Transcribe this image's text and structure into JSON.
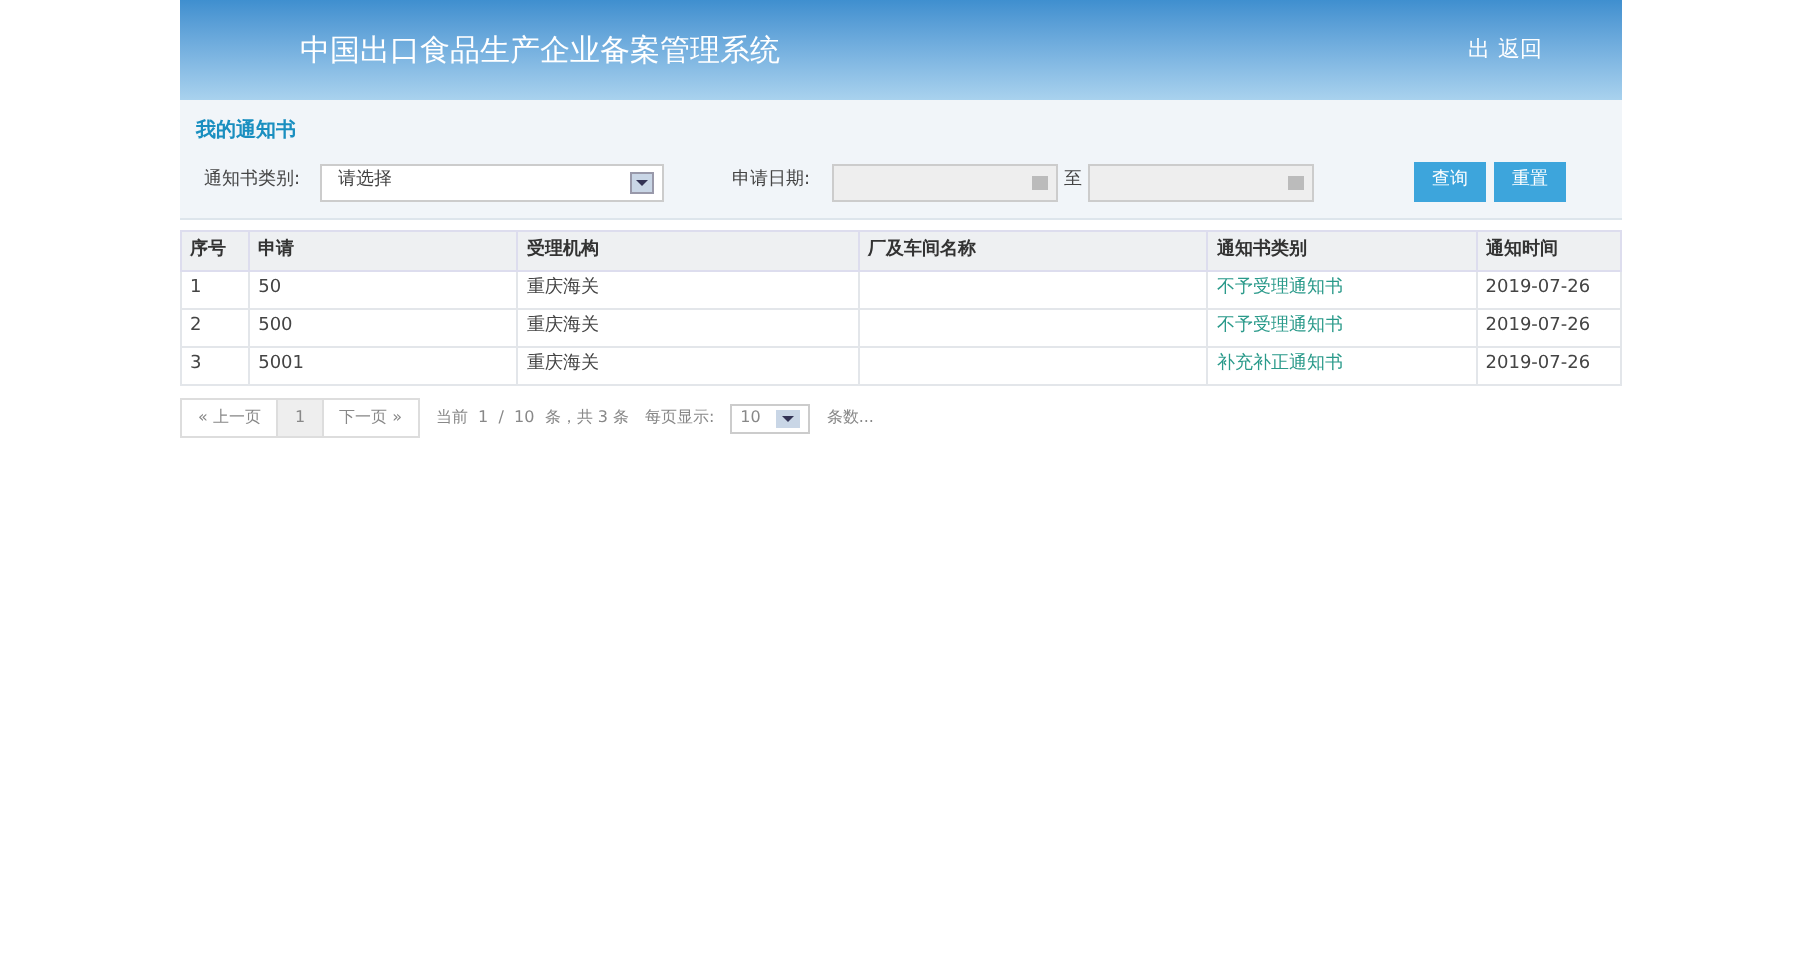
{
  "header": {
    "title": "中国出口食品生产企业备案管理系统",
    "links": [
      "出",
      "返回"
    ]
  },
  "panel": {
    "title": "我的通知书",
    "filters": {
      "type_label": "通知书类别:",
      "type_value": "请选择",
      "date_label": "申请日期:",
      "date_separator": "至"
    },
    "buttons": [
      "查询",
      "重置"
    ]
  },
  "table": {
    "columns": [
      "序号",
      "申请",
      "受理机构",
      "厂及车间名称",
      "通知书类别",
      "通知时间"
    ],
    "rows": [
      {
        "cells": [
          "1",
          "50",
          "重庆海关",
          "",
          "不予受理通知书",
          "2019-07-26"
        ]
      },
      {
        "cells": [
          "2",
          "500",
          "重庆海关",
          "",
          "不予受理通知书",
          "2019-07-26"
        ]
      },
      {
        "cells": [
          "3",
          "5001",
          "重庆海关",
          "",
          "补充补正通知书",
          "2019-07-26"
        ]
      }
    ]
  },
  "pagination": {
    "prev": "« 上一页",
    "pages": [
      {
        "label": "1",
        "selected": true
      }
    ],
    "next": "下一页 »",
    "info": "当前  1  /  10  条，共 3 条",
    "per_page_label": "每页显示:",
    "per_page": "10",
    "suffix": "条数..."
  }
}
